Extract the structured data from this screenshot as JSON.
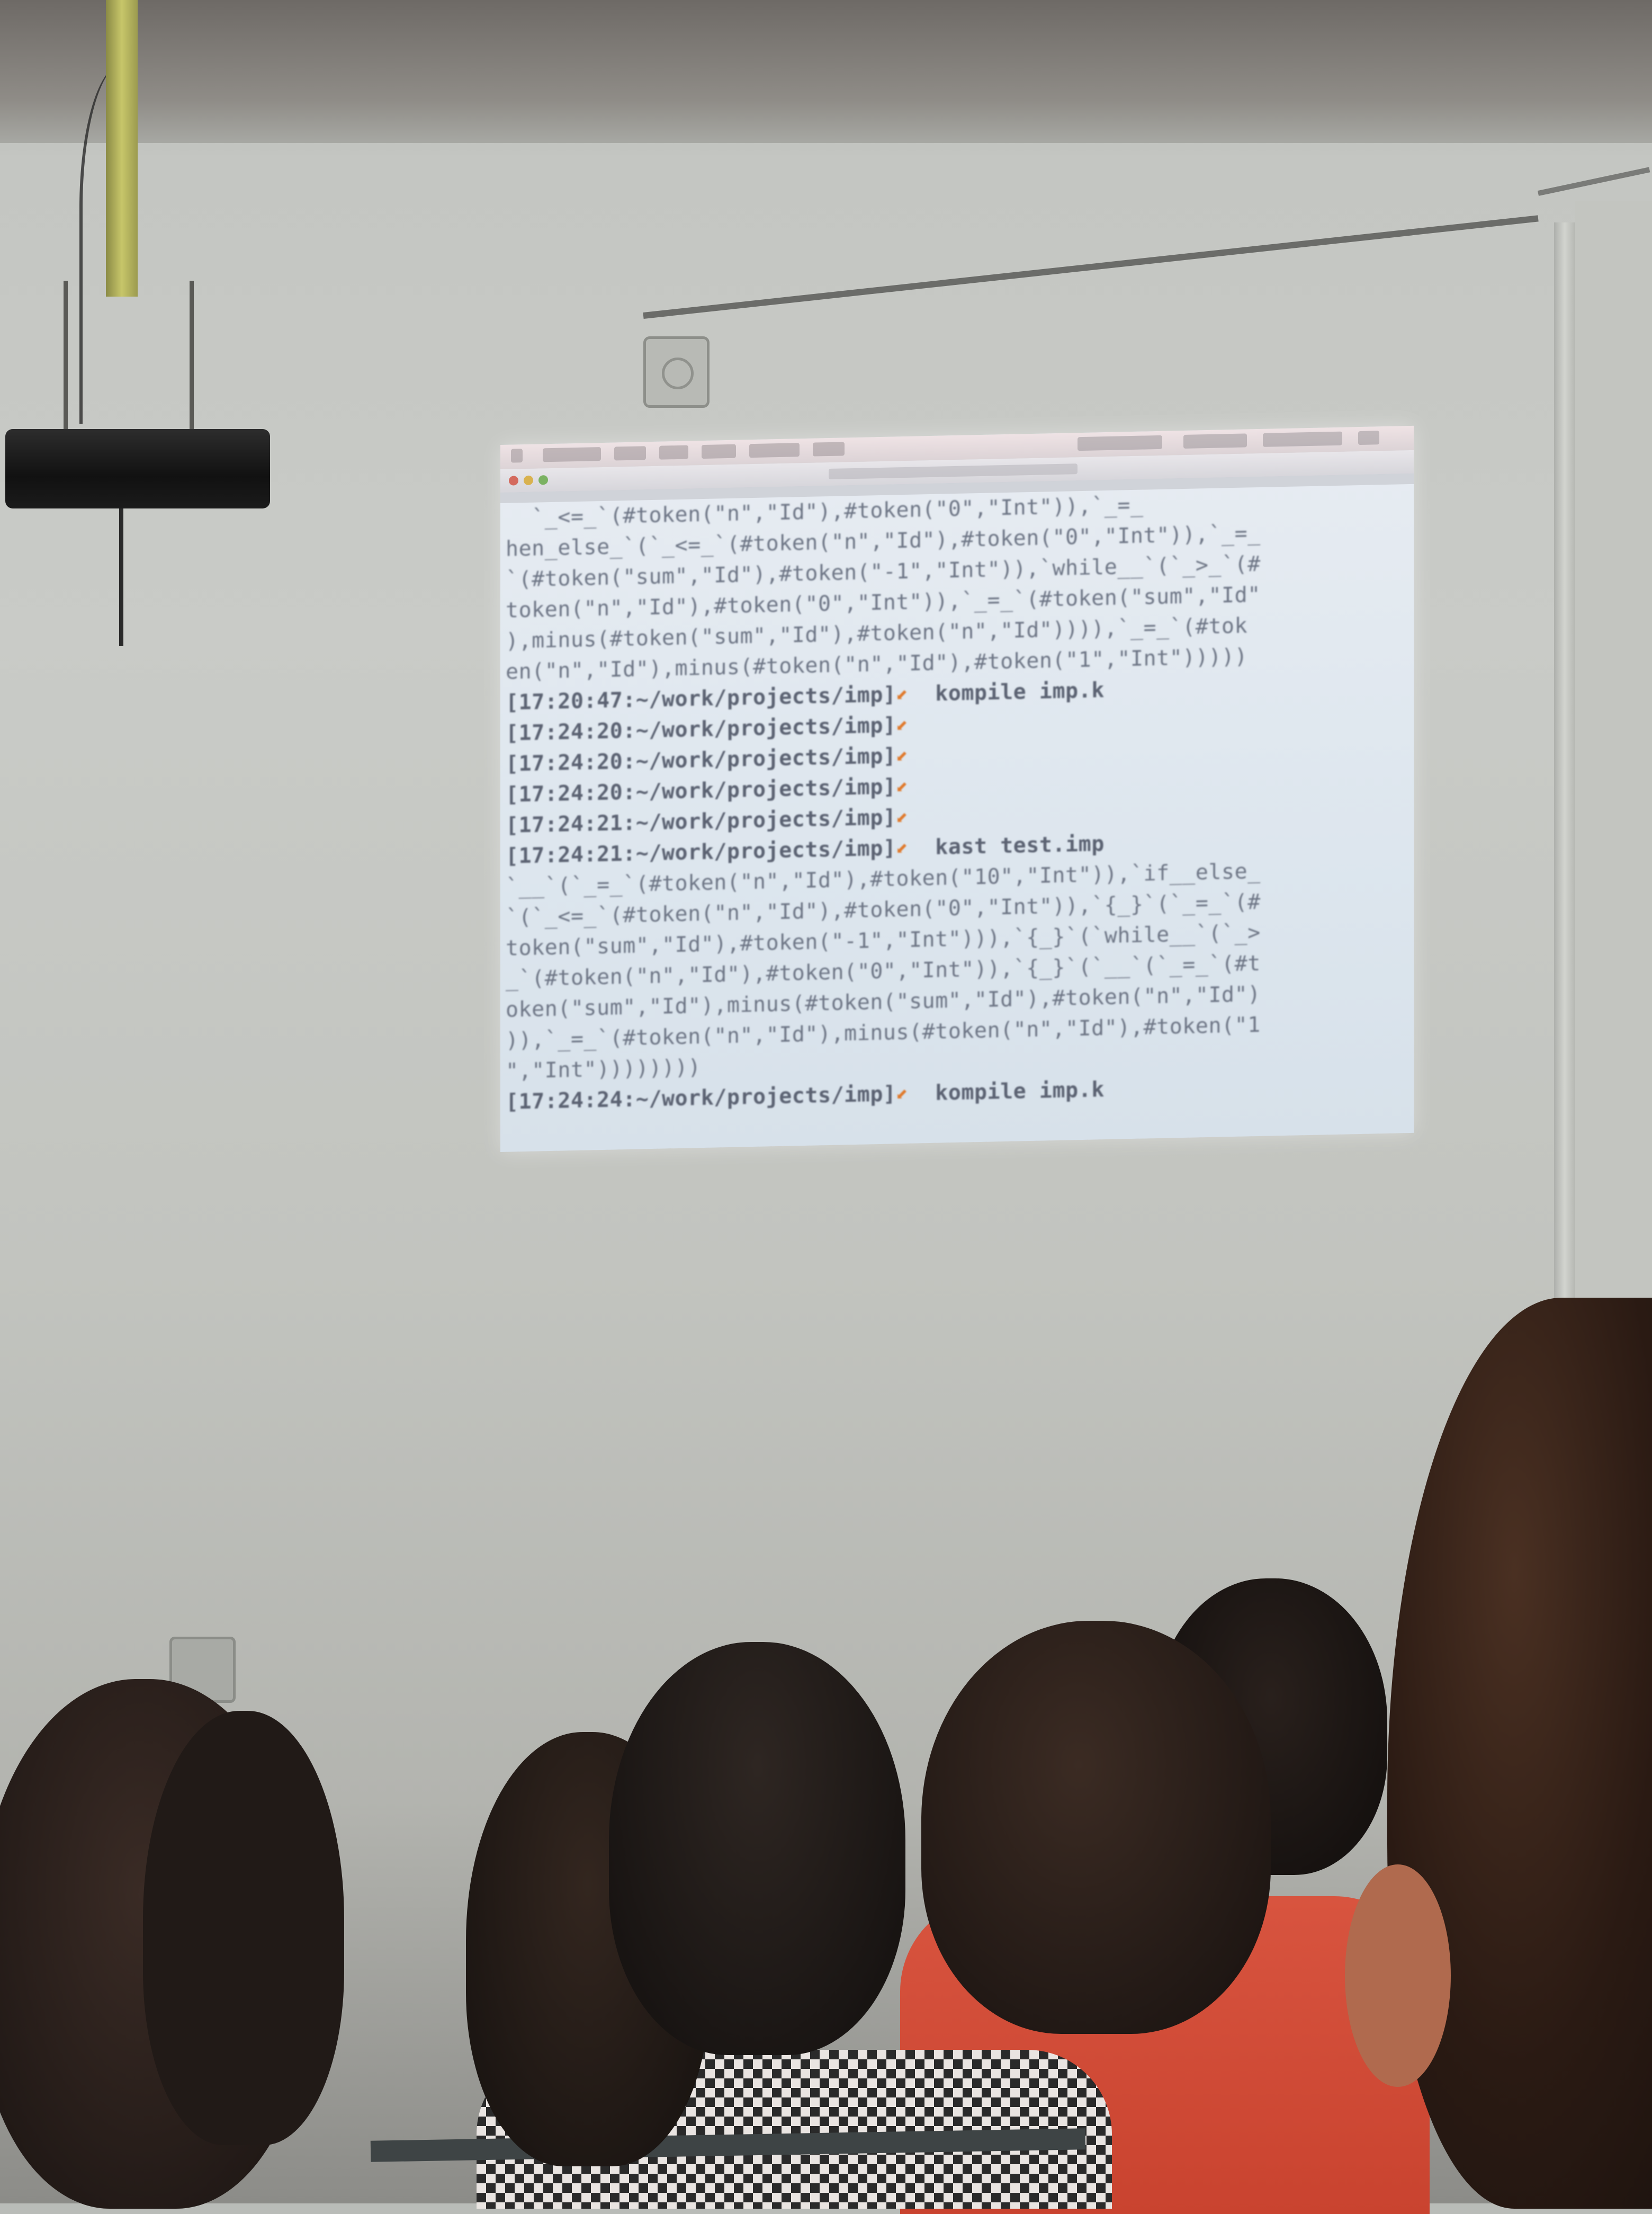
{
  "scene": {
    "description_free": true
  },
  "terminal": {
    "lines": [
      {
        "text": "  `_<=_`(#token(\"n\",\"Id\"),#token(\"0\",\"Int\")),`_=_",
        "bold": false
      },
      {
        "text": "hen_else_`(`_<=_`(#token(\"n\",\"Id\"),#token(\"0\",\"Int\")),`_=_",
        "bold": false
      },
      {
        "text": "`(#token(\"sum\",\"Id\"),#token(\"-1\",\"Int\")),`while__`(`_>_`(#",
        "bold": false
      },
      {
        "text": "token(\"n\",\"Id\"),#token(\"0\",\"Int\")),`_=_`(#token(\"sum\",\"Id\"",
        "bold": false
      },
      {
        "text": "),minus(#token(\"sum\",\"Id\"),#token(\"n\",\"Id\")))),`_=_`(#tok",
        "bold": false
      },
      {
        "text": "en(\"n\",\"Id\"),minus(#token(\"n\",\"Id\"),#token(\"1\",\"Int\")))))",
        "bold": false
      },
      {
        "text": "[17:20:47:~/work/projects/imp]",
        "prompt": true,
        "cmd": "  kompile imp.k"
      },
      {
        "text": "[17:24:20:~/work/projects/imp]",
        "prompt": true,
        "cmd": ""
      },
      {
        "text": "[17:24:20:~/work/projects/imp]",
        "prompt": true,
        "cmd": ""
      },
      {
        "text": "[17:24:20:~/work/projects/imp]",
        "prompt": true,
        "cmd": ""
      },
      {
        "text": "[17:24:21:~/work/projects/imp]",
        "prompt": true,
        "cmd": ""
      },
      {
        "text": "[17:24:21:~/work/projects/imp]",
        "prompt": true,
        "cmd": "  kast test.imp"
      },
      {
        "text": "`__`(`_=_`(#token(\"n\",\"Id\"),#token(\"10\",\"Int\")),`if__else_",
        "bold": false
      },
      {
        "text": "`(`_<=_`(#token(\"n\",\"Id\"),#token(\"0\",\"Int\")),`{_}`(`_=_`(#",
        "bold": false
      },
      {
        "text": "token(\"sum\",\"Id\"),#token(\"-1\",\"Int\"))),`{_}`(`while__`(`_>",
        "bold": false
      },
      {
        "text": "_`(#token(\"n\",\"Id\"),#token(\"0\",\"Int\")),`{_}`(`__`(`_=_`(#t",
        "bold": false
      },
      {
        "text": "oken(\"sum\",\"Id\"),minus(#token(\"sum\",\"Id\"),#token(\"n\",\"Id\")",
        "bold": false
      },
      {
        "text": ")),`_=_`(#token(\"n\",\"Id\"),minus(#token(\"n\",\"Id\"),#token(\"1",
        "bold": false
      },
      {
        "text": "\",\"Int\"))))))))",
        "bold": false
      },
      {
        "text": "[17:24:24:~/work/projects/imp]",
        "prompt": true,
        "cmd": "  kompile imp.k"
      }
    ],
    "prompt_marker_color": "#e07a2c",
    "text_color": "#6d7585",
    "background_color": "#dfe7ef"
  },
  "colors": {
    "wall": "#c6c8c3",
    "red_shirt": "#d04a35",
    "hair": "#1e1a18"
  }
}
